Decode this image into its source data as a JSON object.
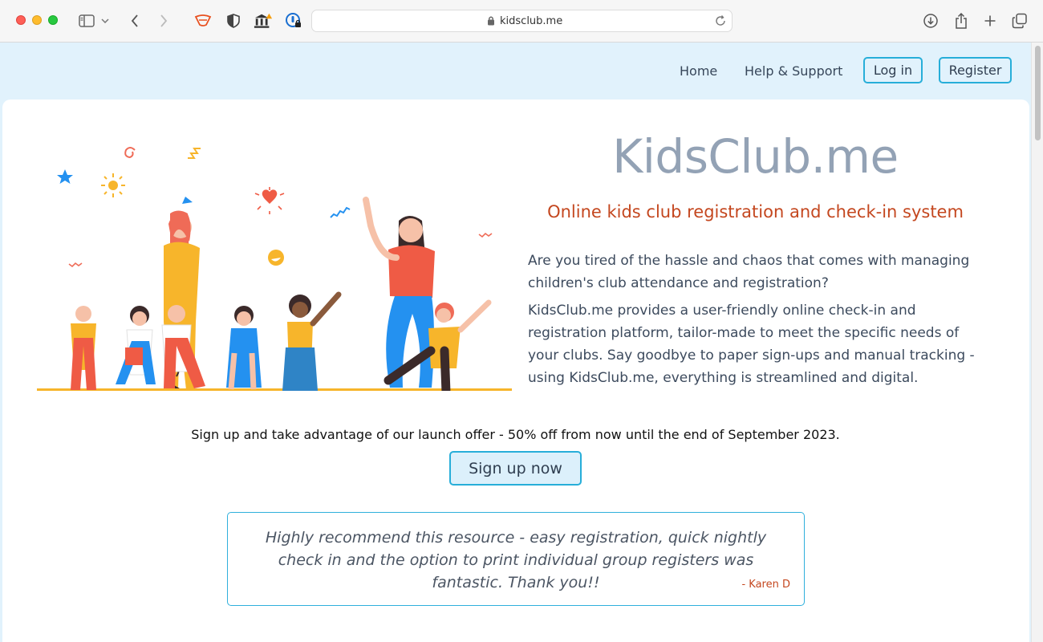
{
  "browser": {
    "url": "kidsclub.me",
    "icons": [
      "sidebar-icon",
      "chevron-down-icon",
      "back-icon",
      "forward-icon",
      "extension-icon",
      "shield-icon",
      "bank-icon",
      "password-icon",
      "download-icon",
      "share-icon",
      "new-tab-icon",
      "tabs-icon"
    ]
  },
  "nav": {
    "home": "Home",
    "help": "Help & Support",
    "login": "Log in",
    "register": "Register"
  },
  "hero": {
    "title": "KidsClub.me",
    "subtitle": "Online kids club registration and check-in system",
    "paragraph1": "Are you tired of the hassle and chaos that comes with managing children's club attendance and registration?",
    "paragraph2": "KidsClub.me provides a user-friendly online check-in and registration platform, tailor-made to meet the specific needs of your clubs. Say goodbye to paper sign-ups and manual tracking - using KidsClub.me, everything is streamlined and digital."
  },
  "offer": {
    "text": "Sign up and take advantage of our launch offer - 50% off from now until the end of September 2023.",
    "button": "Sign up now"
  },
  "testimonial": {
    "quote": "Highly recommend this resource - easy registration, quick nightly check in and the option to print individual group registers was fantastic. Thank you!!",
    "author": "- Karen D"
  },
  "colors": {
    "accent": "#27aed9",
    "title": "#93a2b5",
    "subtitle": "#c4471f",
    "page_bg": "#e1f2fc"
  }
}
